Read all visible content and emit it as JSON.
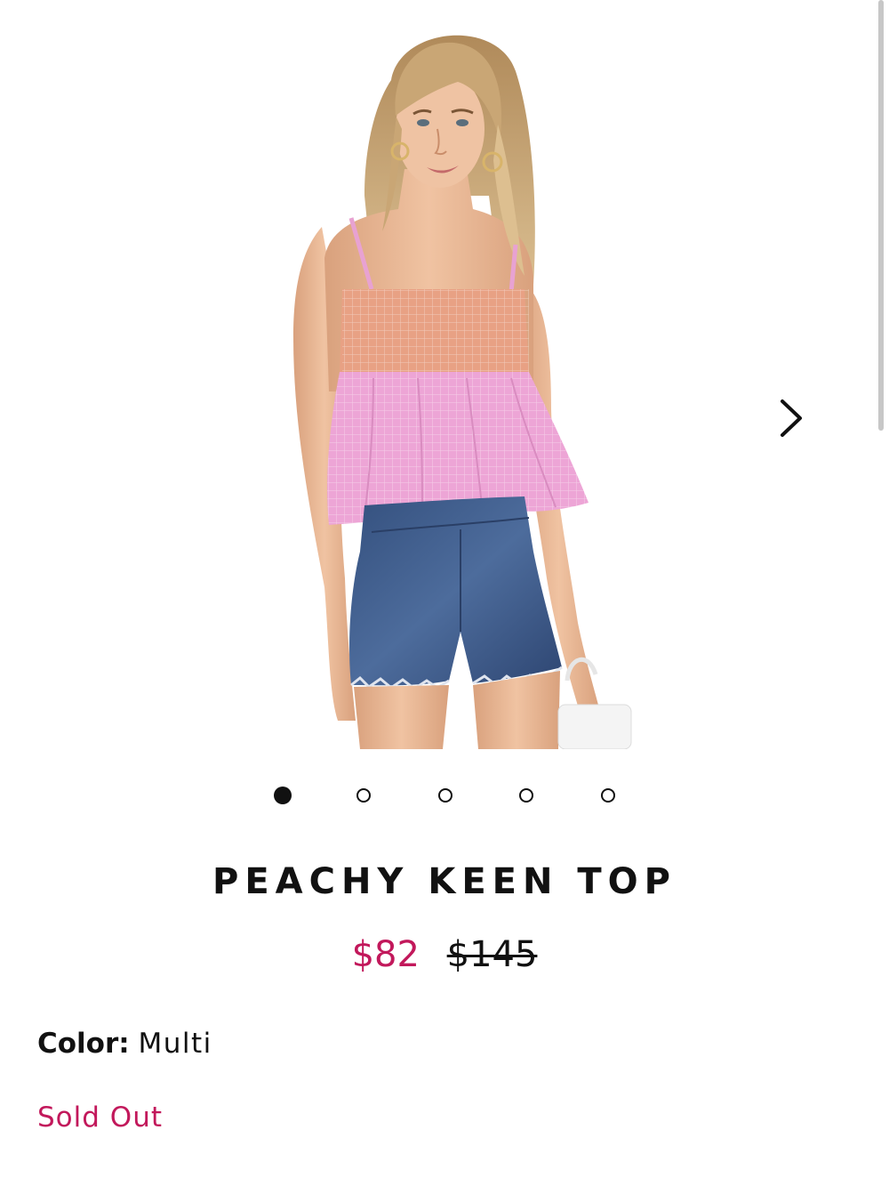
{
  "gallery": {
    "image_alt": "",
    "next_icon": "chevron-right-icon",
    "slide_count": 5,
    "active_slide": 1
  },
  "product": {
    "name": "PEACHY KEEN TOP",
    "sale_price": "$82",
    "original_price": "$145",
    "color_label": "Color:",
    "color_value": "Multi",
    "stock_status": "Sold Out"
  },
  "colors": {
    "accent": "#c2185b",
    "text": "#111111",
    "top_peach": "#e8a184",
    "top_pink": "#eda5d6",
    "denim": "#3e5d8e"
  }
}
